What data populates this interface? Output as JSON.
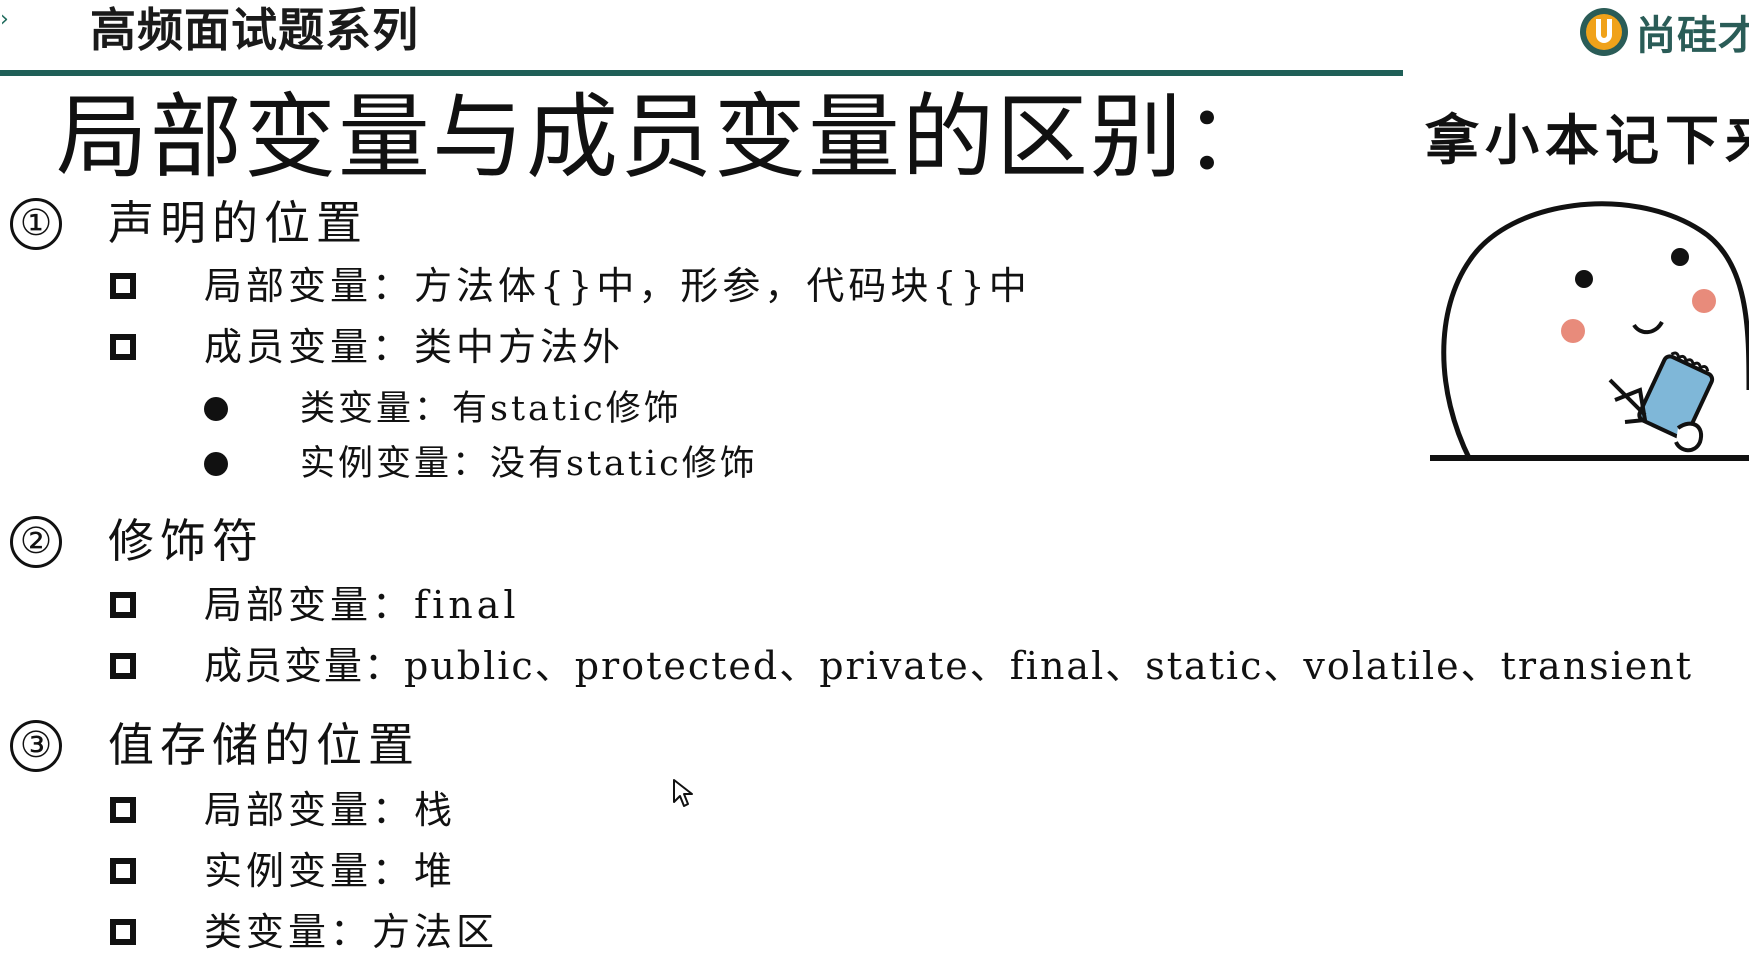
{
  "header": {
    "series_title": "高频面试题系列",
    "logo_text": "尚硅才",
    "logo_icon": "u-logo-icon",
    "accent_color": "#1f5f57"
  },
  "slide": {
    "title": "局部变量与成员变量的区别：",
    "sticker_caption": "拿小本记下来",
    "sticker_icon": "note-taking-character-icon"
  },
  "sections": [
    {
      "number": "①",
      "title": "声明的位置",
      "items": [
        {
          "text": "局部变量：方法体{}中，形参，代码块{}中"
        },
        {
          "text": "成员变量：类中方法外"
        }
      ],
      "sub_items": [
        {
          "text": "类变量：有static修饰"
        },
        {
          "text": "实例变量：没有static修饰"
        }
      ]
    },
    {
      "number": "②",
      "title": "修饰符",
      "items": [
        {
          "text": "局部变量：final"
        },
        {
          "text": "成员变量：public、protected、private、final、static、volatile、transient"
        }
      ]
    },
    {
      "number": "③",
      "title": "值存储的位置",
      "items": [
        {
          "text": "局部变量：栈"
        },
        {
          "text": "实例变量：堆"
        },
        {
          "text": "类变量：方法区"
        }
      ]
    }
  ],
  "cursor_icon": "mouse-pointer-icon"
}
